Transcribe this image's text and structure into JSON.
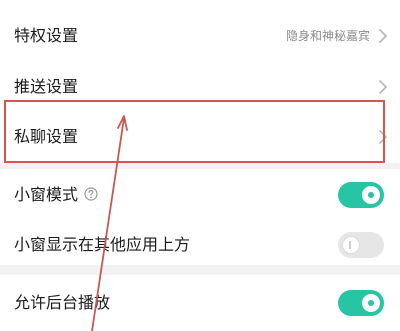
{
  "settings": {
    "privilege": {
      "label": "特权设置",
      "value": "隐身和神秘嘉宾",
      "icon": "chevron-right-icon"
    },
    "push": {
      "label": "推送设置",
      "icon": "chevron-right-icon"
    },
    "private_chat": {
      "label": "私聊设置",
      "icon": "chevron-right-icon"
    },
    "small_window": {
      "label": "小窗模式",
      "help_icon": "help-circle-icon",
      "enabled": true
    },
    "small_window_overlay": {
      "label": "小窗显示在其他应用上方",
      "enabled": false
    },
    "background_play": {
      "label": "允许后台播放",
      "enabled": true
    }
  },
  "colors": {
    "accent": "#27c5a3",
    "annotation": "#d9534f",
    "background": "#f2f2f2"
  }
}
